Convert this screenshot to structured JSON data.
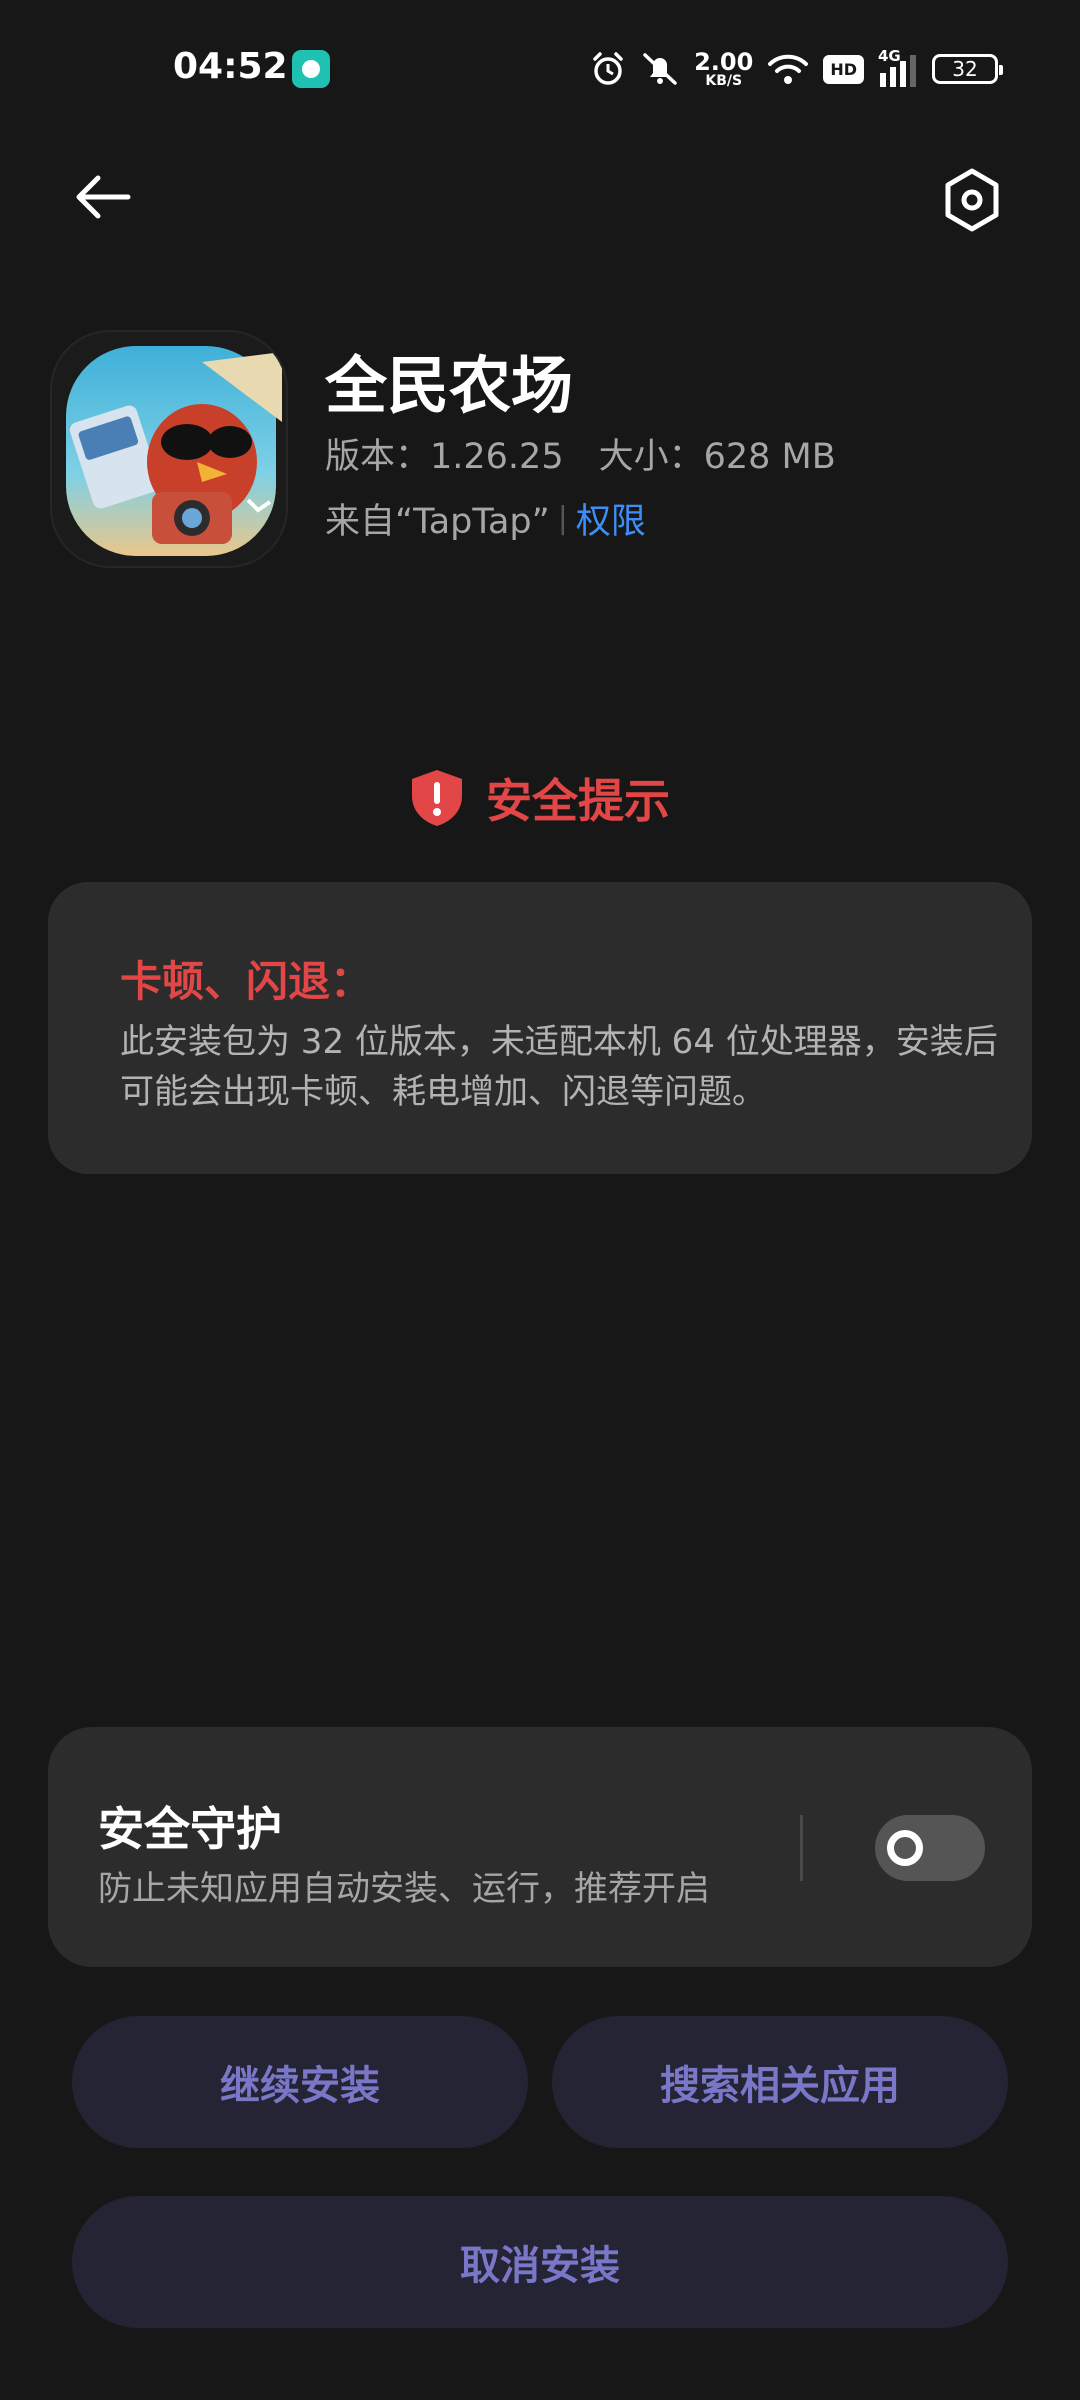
{
  "status_bar": {
    "time": "04:52",
    "net_speed_value": "2.00",
    "net_speed_unit": "KB/S",
    "hd_label": "HD",
    "signal_label": "4G",
    "battery": "32"
  },
  "app": {
    "name": "全民农场",
    "meta": "版本：1.26.25　大小：628 MB",
    "source": "来自“TapTap”",
    "separator": "|",
    "permissions_link": "权限"
  },
  "security": {
    "title": "安全提示",
    "warning_title": "卡顿、闪退：",
    "warning_body": "此安装包为 32 位版本，未适配本机 64 位处理器，安装后可能会出现卡顿、耗电增加、闪退等问题。"
  },
  "guard": {
    "title": "安全守护",
    "description": "防止未知应用自动安装、运行，推荐开启",
    "toggle_on": false
  },
  "buttons": {
    "continue": "继续安装",
    "search": "搜索相关应用",
    "cancel": "取消安装"
  },
  "colors": {
    "background": "#171717",
    "card": "#2c2c2c",
    "danger": "#e24646",
    "link": "#3e8ef7",
    "button_bg": "#242434",
    "button_text": "#7a77c8"
  },
  "icons": [
    "back-arrow-icon",
    "settings-gear-icon",
    "alarm-icon",
    "bell-muted-icon",
    "wifi-icon",
    "signal-icon",
    "battery-icon",
    "shield-alert-icon"
  ]
}
